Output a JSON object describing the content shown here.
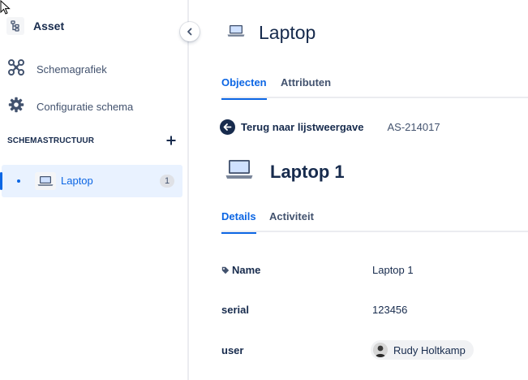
{
  "sidebar": {
    "brand": {
      "label": "Asset",
      "icon": "schema-tree-icon"
    },
    "nav": [
      {
        "label": "Schemagrafiek",
        "icon": "graph-icon"
      },
      {
        "label": "Configuratie schema",
        "icon": "gear-icon"
      }
    ],
    "section": {
      "title": "SCHEMASTRUCTUUR",
      "add_icon": "plus-icon"
    },
    "tree": [
      {
        "label": "Laptop",
        "count": "1",
        "icon": "laptop-icon"
      }
    ],
    "collapse_icon": "chevron-left-icon"
  },
  "page": {
    "title": "Laptop",
    "icon": "laptop-icon",
    "tabs": [
      {
        "label": "Objecten",
        "active": true
      },
      {
        "label": "Attributen",
        "active": false
      }
    ]
  },
  "object": {
    "back_label": "Terug naar lijstweergave",
    "key": "AS-214017",
    "title": "Laptop 1",
    "icon": "laptop-icon",
    "tabs": [
      {
        "label": "Details",
        "active": true
      },
      {
        "label": "Activiteit",
        "active": false
      }
    ],
    "attributes": [
      {
        "label": "Name",
        "value": "Laptop 1",
        "icon": "tag-icon"
      },
      {
        "label": "serial",
        "value": "123456"
      },
      {
        "label": "user",
        "value": "Rudy Holtkamp",
        "icon": "avatar-icon"
      }
    ]
  },
  "colors": {
    "accent": "#0c66e4",
    "text": "#172b4d",
    "subtle": "#42526e",
    "selected_bg": "#e9f2ff"
  }
}
